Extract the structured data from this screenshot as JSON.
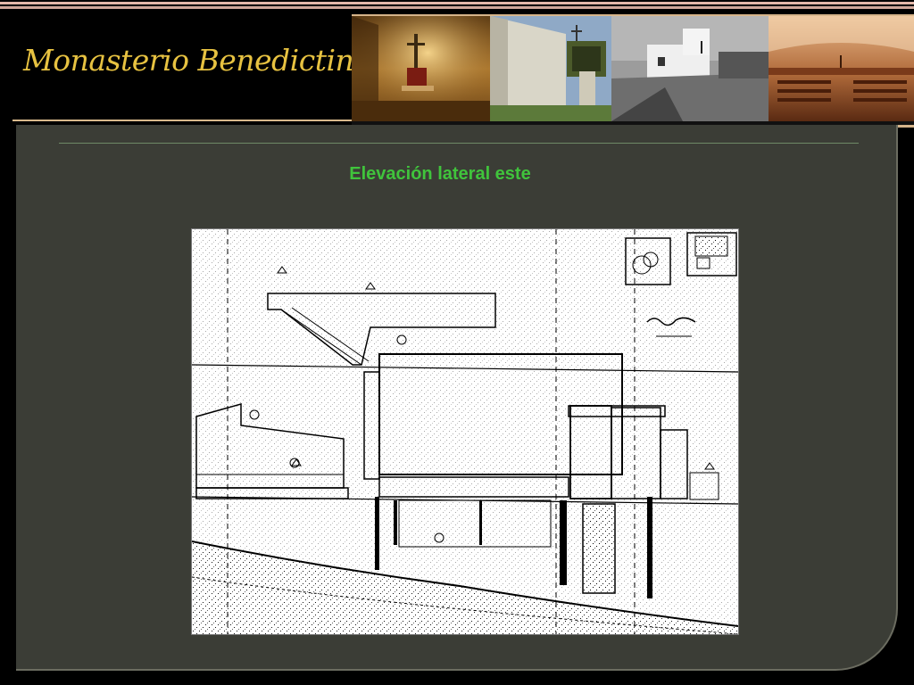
{
  "header": {
    "site_title": "Monasterio Benedictino",
    "photos": [
      {
        "name": "chapel-altar-photo"
      },
      {
        "name": "bell-tower-photo"
      },
      {
        "name": "monastery-exterior-photo"
      },
      {
        "name": "chapel-interior-photo"
      }
    ]
  },
  "slide": {
    "title": "Elevación lateral este"
  },
  "drawing": {
    "stamp_text": "",
    "icon": "architectural-elevation-drawing"
  },
  "colors": {
    "background": "#000000",
    "panel": "#3b3d36",
    "title_gold": "#e7c241",
    "slide_title_green": "#40c43c",
    "accent_stripe": "#d6b48a"
  }
}
